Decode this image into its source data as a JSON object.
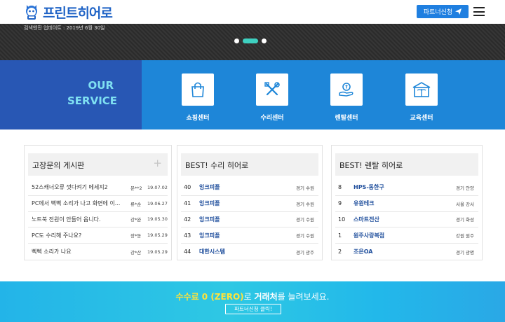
{
  "header": {
    "logo_text": "프린트히어로",
    "partner_button": "파트너신청",
    "colors": {
      "brand": "#1f63c6",
      "button": "#1f7fe0"
    }
  },
  "banner": {
    "update_text": "검색엔진 업데이트 : 2019년 6월 30일"
  },
  "service": {
    "title_line1": "OUR",
    "title_line2": "SERVICE",
    "items": [
      {
        "label": "쇼핑센터",
        "icon": "shopping-bag-icon"
      },
      {
        "label": "수리센터",
        "icon": "tools-icon"
      },
      {
        "label": "렌탈센터",
        "icon": "rental-hand-icon"
      },
      {
        "label": "교육센터",
        "icon": "school-building-icon"
      }
    ]
  },
  "boards": {
    "qna": {
      "title": "고장문의 게시판",
      "rows": [
        {
          "title": "52스캐너오류 껏다켜기 메세지2",
          "author": "문**2",
          "date": "19.07.02"
        },
        {
          "title": "PC에서 삑삑 소리가 나고 화면에 이...",
          "author": "류*순",
          "date": "19.06.27"
        },
        {
          "title": "노트북 전원이 안들어 옵니다.",
          "author": "강*완",
          "date": "19.05.30"
        },
        {
          "title": "PC도 수리해 주나요?",
          "author": "장*동",
          "date": "19.05.29"
        },
        {
          "title": "삑삑 소리가 나요",
          "author": "강*산",
          "date": "19.05.29"
        }
      ]
    },
    "repair": {
      "title": "BEST! 수리 히어로",
      "rows": [
        {
          "num": "40",
          "name": "잉크피플",
          "loc": "경기 수원"
        },
        {
          "num": "41",
          "name": "잉크피플",
          "loc": "경기 수원"
        },
        {
          "num": "42",
          "name": "잉크피플",
          "loc": "경기 수원"
        },
        {
          "num": "43",
          "name": "잉크피플",
          "loc": "경기 수원"
        },
        {
          "num": "44",
          "name": "대한시스템",
          "loc": "경기 광주"
        }
      ]
    },
    "rental": {
      "title": "BEST! 렌탈 히어로",
      "rows": [
        {
          "num": "8",
          "name": "HPS-동한구",
          "loc": "경기 안양"
        },
        {
          "num": "9",
          "name": "유원테크",
          "loc": "서울 강서"
        },
        {
          "num": "10",
          "name": "스마트전산",
          "loc": "경기 화성"
        },
        {
          "num": "1",
          "name": "원주사랑복점",
          "loc": "강원 원주"
        },
        {
          "num": "2",
          "name": "조은OA",
          "loc": "경기 광명"
        }
      ]
    }
  },
  "footer": {
    "highlight": "수수료 0 (ZERO)",
    "mid": "로 ",
    "bold": "거래처",
    "tail": "를 늘려보세요.",
    "button": "파트너신청 클릭!"
  }
}
